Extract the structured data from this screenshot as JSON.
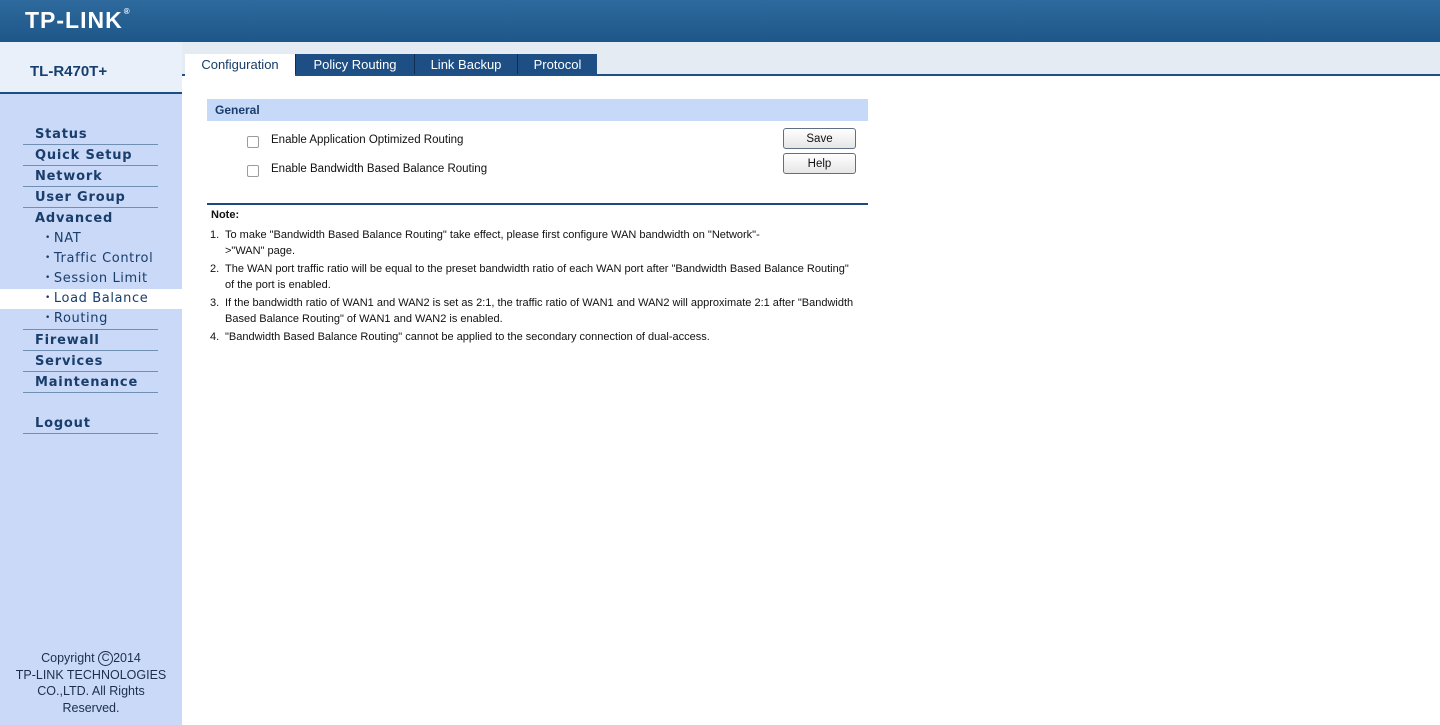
{
  "header": {
    "logo": "TP-LINK",
    "logo_mark": "®"
  },
  "sidebar": {
    "model": "TL-R470T+",
    "nav": [
      {
        "label": "Status"
      },
      {
        "label": "Quick Setup"
      },
      {
        "label": "Network"
      },
      {
        "label": "User Group"
      },
      {
        "label": "Advanced"
      },
      {
        "label": "Firewall"
      },
      {
        "label": "Services"
      },
      {
        "label": "Maintenance"
      },
      {
        "label": "Logout"
      }
    ],
    "advanced_sub": [
      {
        "label": "NAT"
      },
      {
        "label": "Traffic Control"
      },
      {
        "label": "Session Limit"
      },
      {
        "label": "Load Balance",
        "active": true
      },
      {
        "label": "Routing"
      }
    ],
    "copyright": {
      "line1_prefix": "Copyright",
      "symbol": "C",
      "year": "2014",
      "line2": "TP-LINK TECHNOLOGIES",
      "line3": "CO.,LTD. All Rights",
      "line4": "Reserved."
    }
  },
  "tabs": [
    {
      "label": "Configuration",
      "active": true
    },
    {
      "label": "Policy Routing"
    },
    {
      "label": "Link Backup"
    },
    {
      "label": "Protocol"
    }
  ],
  "general": {
    "title": "General",
    "options": [
      {
        "label": "Enable Application Optimized Routing",
        "checked": false
      },
      {
        "label": "Enable Bandwidth Based Balance Routing",
        "checked": false
      }
    ],
    "save_label": "Save",
    "help_label": "Help"
  },
  "note": {
    "title": "Note:",
    "items": [
      {
        "num": "1.",
        "text": "To make \"Bandwidth Based Balance Routing\" take effect, please first configure WAN bandwidth on \"Network\"->\"WAN\" page."
      },
      {
        "num": "2.",
        "text": "The WAN port traffic ratio will be equal to the preset bandwidth ratio of each WAN port after \"Bandwidth Based Balance Routing\" of the port is enabled."
      },
      {
        "num": "3.",
        "text": "If the bandwidth ratio of WAN1 and WAN2 is set as 2:1, the traffic ratio of WAN1 and WAN2 will approximate 2:1 after \"Bandwidth Based Balance Routing\" of WAN1 and WAN2 is enabled."
      },
      {
        "num": "4.",
        "text": "\"Bandwidth Based Balance Routing\" cannot be applied to the secondary connection of dual-access."
      }
    ]
  }
}
